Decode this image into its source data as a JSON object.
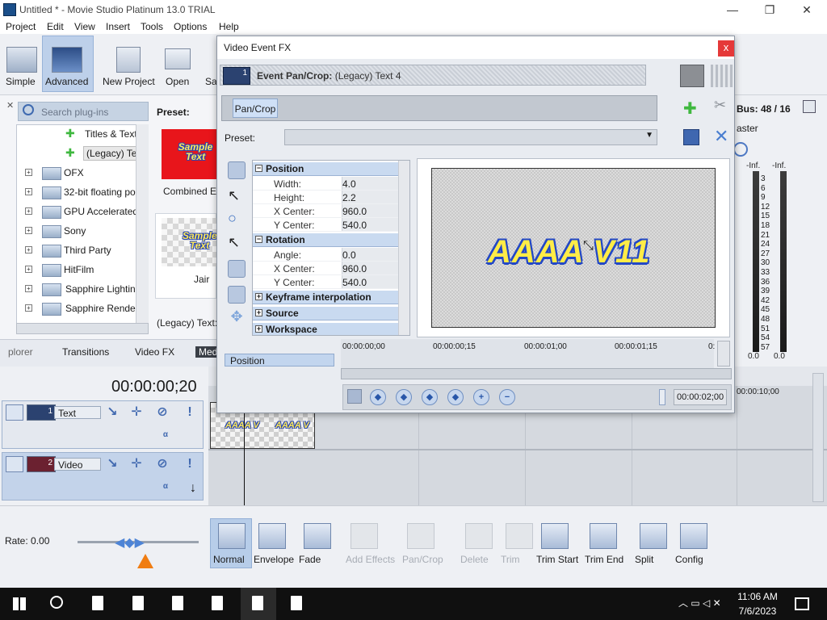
{
  "app": {
    "title": "Untitled * - Movie Studio Platinum 13.0 TRIAL",
    "min_glyph": "—",
    "max_glyph": "❐",
    "close_glyph": "✕"
  },
  "menu": [
    "Project",
    "Edit",
    "View",
    "Insert",
    "Tools",
    "Options",
    "Help"
  ],
  "toolbar": {
    "simple": "Simple",
    "advanced": "Advanced",
    "new_project": "New Project",
    "open": "Open",
    "save_partial": "Sa"
  },
  "plugins": {
    "search_placeholder": "Search plug-ins",
    "tree": [
      {
        "label": "Titles & Text",
        "kind": "fx"
      },
      {
        "label": "(Legacy) Tex",
        "kind": "fx-selected"
      },
      {
        "label": "OFX",
        "kind": "folder"
      },
      {
        "label": "32-bit floating poin",
        "kind": "folder"
      },
      {
        "label": "GPU Accelerated",
        "kind": "folder"
      },
      {
        "label": "Sony",
        "kind": "folder"
      },
      {
        "label": "Third Party",
        "kind": "folder"
      },
      {
        "label": "HitFilm",
        "kind": "folder"
      },
      {
        "label": "Sapphire Lighting",
        "kind": "folder"
      },
      {
        "label": "Sapphire Render",
        "kind": "folder"
      }
    ]
  },
  "presets": {
    "label": "Preset:",
    "items": [
      {
        "thumb_text": "Sample Text",
        "caption": "Combined Effe"
      },
      {
        "thumb_text": "Sample Text",
        "caption": "Jair"
      }
    ],
    "footer": "(Legacy) Text: D"
  },
  "tabs": [
    "plorer",
    "Transitions",
    "Video FX",
    "Medi"
  ],
  "timecode": "00:00:00;20",
  "tracks": [
    {
      "name": "Text",
      "number": "1"
    },
    {
      "name": "Video",
      "number": "2"
    }
  ],
  "clip": {
    "label": "AAAA V"
  },
  "rate": "Rate: 0.00",
  "bottom_tools": [
    {
      "label": "Normal",
      "disabled": false
    },
    {
      "label": "Envelope",
      "disabled": false
    },
    {
      "label": "Fade",
      "disabled": false
    },
    {
      "label": "Add Effects",
      "disabled": true
    },
    {
      "label": "Pan/Crop",
      "disabled": true
    },
    {
      "label": "Delete",
      "disabled": true
    },
    {
      "label": "Trim",
      "disabled": true
    },
    {
      "label": "Trim Start",
      "disabled": false
    },
    {
      "label": "Trim End",
      "disabled": false
    },
    {
      "label": "Split",
      "disabled": false
    },
    {
      "label": "Config",
      "disabled": false
    }
  ],
  "bus": {
    "label": "Bus: 48 / 16",
    "master": "aster"
  },
  "meters": {
    "top": [
      "-Inf.",
      "-Inf."
    ],
    "scale": [
      "3",
      "6",
      "9",
      "12",
      "15",
      "18",
      "21",
      "24",
      "27",
      "30",
      "33",
      "36",
      "39",
      "42",
      "45",
      "48",
      "51",
      "54",
      "57"
    ],
    "bottom": [
      "0.0",
      "0.0"
    ]
  },
  "timeline_right": "00:00:10;00",
  "dialog": {
    "title": "Video Event FX",
    "close": "x",
    "event_label": "Event Pan/Crop:",
    "event_name": "(Legacy) Text 4",
    "event_num": "1",
    "chain_button": "Pan/Crop",
    "preset_label": "Preset:",
    "groups": {
      "position": {
        "title": "Position",
        "rows": [
          {
            "k": "Width:",
            "v": "4.0"
          },
          {
            "k": "Height:",
            "v": "2.2"
          },
          {
            "k": "X Center:",
            "v": "960.0"
          },
          {
            "k": "Y Center:",
            "v": "540.0"
          }
        ]
      },
      "rotation": {
        "title": "Rotation",
        "rows": [
          {
            "k": "Angle:",
            "v": "0.0"
          },
          {
            "k": "X Center:",
            "v": "960.0"
          },
          {
            "k": "Y Center:",
            "v": "540.0"
          }
        ]
      },
      "keyframe": "Keyframe interpolation",
      "source": "Source",
      "workspace": "Workspace"
    },
    "preview_text": "AAAA V11",
    "keyframe_label": "Position",
    "ruler": [
      "00:00:00;00",
      "00:00:00;15",
      "00:00:01;00",
      "00:00:01;15",
      "0:"
    ],
    "end_time": "00:00:02;00"
  },
  "clock": {
    "time": "11:06 AM",
    "date": "7/6/2023"
  }
}
